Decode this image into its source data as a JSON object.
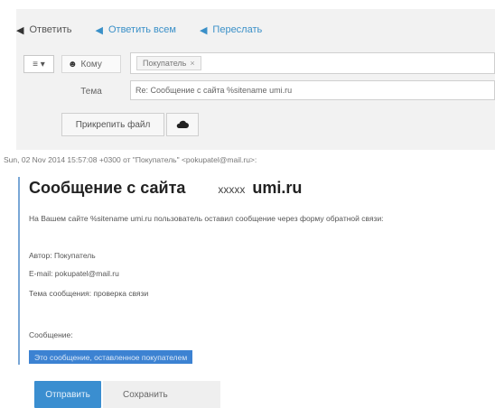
{
  "toolbar": {
    "reply": "Ответить",
    "reply_all": "Ответить всем",
    "forward": "Переслать"
  },
  "compose": {
    "header_toggle": "≡ ▾",
    "to_label": "Кому",
    "to_chip": "Покупатель",
    "subject_label": "Тема",
    "subject_value": "Re: Сообщение с сайта %sitename umi.ru",
    "attach_label": "Прикрепить файл"
  },
  "quote": {
    "header": "Sun, 02 Nov 2014 15:57:08 +0300 от \"Покупатель\" <pokupatel@mail.ru>:",
    "title_left": "Сообщение с сайта",
    "title_mid": "xxxxx",
    "title_right": "umi.ru",
    "intro": "На Вашем сайте %sitename umi.ru пользователь оставил сообщение через форму обратной связи:",
    "author": "Автор: Покупатель",
    "email": "E-mail: pokupatel@mail.ru",
    "topic": "Тема сообщения: проверка связи",
    "message_label": "Сообщение:",
    "message_text": "Это сообщение, оставленное покупателем"
  },
  "actions": {
    "send": "Отправить",
    "save": "Сохранить"
  },
  "icons": [
    "reply-icon",
    "reply-all-icon",
    "forward-icon",
    "person-icon",
    "cloud-upload-icon"
  ],
  "colors": {
    "accent": "#3a8ed0",
    "link_blue": "#3a90c8",
    "highlight": "#3c82d2"
  }
}
